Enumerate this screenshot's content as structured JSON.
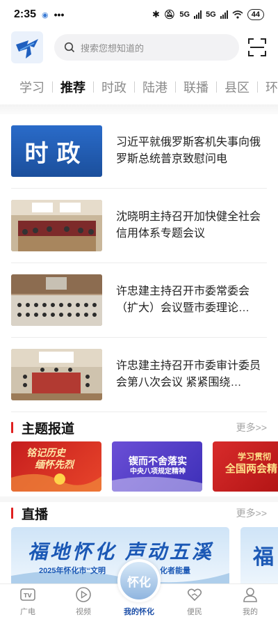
{
  "status": {
    "time": "2:35",
    "battery": "44",
    "signal1": "5G",
    "signal2": "5G"
  },
  "search": {
    "placeholder": "搜索您想知道的"
  },
  "tabs": [
    {
      "label": "学习"
    },
    {
      "label": "推荐"
    },
    {
      "label": "时政"
    },
    {
      "label": "陆港"
    },
    {
      "label": "联播"
    },
    {
      "label": "县区"
    },
    {
      "label": "环"
    }
  ],
  "news": [
    {
      "title": "习近平就俄罗斯客机失事向俄罗斯总统普京致慰问电",
      "thumb_text": "时政"
    },
    {
      "title": "沈晓明主持召开加快健全社会信用体系专题会议"
    },
    {
      "title": "许忠建主持召开市委常委会（扩大）会议暨市委理论…"
    },
    {
      "title": "许忠建主持召开市委审计委员会第八次会议 紧紧围绕…"
    }
  ],
  "topics_section": {
    "title": "主题报道",
    "more": "更多>>"
  },
  "topics": [
    {
      "line1": "铭记历史",
      "line2": "缅怀先烈"
    },
    {
      "line1": "锲而不舍落实",
      "line2": "中央八项规定精神"
    },
    {
      "line1": "学习贯彻",
      "line2": "全国两会精"
    }
  ],
  "live_section": {
    "title": "直播",
    "more": "更多>>"
  },
  "live": {
    "headline": "福地怀化 声动五溪",
    "subline": "2025年怀化市“文明",
    "subline2": "化者能量"
  },
  "bottom_nav": [
    {
      "label": "广电",
      "icon": "tv-icon"
    },
    {
      "label": "视频",
      "icon": "play-icon"
    },
    {
      "label": "我的怀化",
      "icon": "huaihua-logo",
      "badge": "怀化"
    },
    {
      "label": "便民",
      "icon": "heart-hand-icon"
    },
    {
      "label": "我的",
      "icon": "user-icon"
    }
  ],
  "colors": {
    "accent": "#1d4fa8",
    "section_bar": "#e02020"
  }
}
